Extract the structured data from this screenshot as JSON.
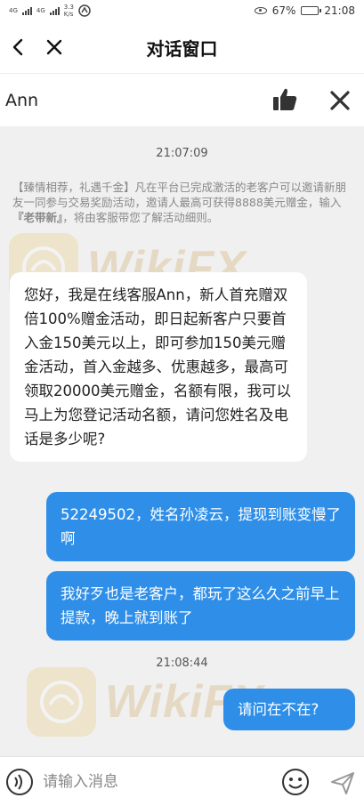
{
  "status_bar": {
    "net_label_1": "4G",
    "net_label_2": "4G",
    "speed_value": "3.3",
    "speed_unit": "K/s",
    "battery_percent": "67%",
    "battery_level": 0.67,
    "time": "21:08"
  },
  "titlebar": {
    "title": "对话窗口",
    "back_icon": "chevron-left-icon",
    "close_icon": "close-icon"
  },
  "agentbar": {
    "name": "Ann",
    "like_icon": "thumbs-up-icon",
    "close_icon": "close-icon"
  },
  "chat": {
    "timestamp_1": "21:07:09",
    "notice": {
      "part1": "【臻情相荐，礼遇千金】凡在平台已完成激活的老客户可以邀请新朋友一同参与交易奖励活动，邀请人最高可获得8888美元赠金，输入",
      "highlight": "『老带新』",
      "part2": "，将由客服带您了解活动细则。"
    },
    "agent_message": "您好，我是在线客服Ann，新人首充赠双倍100%赠金活动，即日起新客户只要首入金150美元以上，即可参加150美元赠金活动，首入金越多、优惠越多，最高可领取20000美元赠金，名额有限，我可以马上为您登记活动名额，请问您姓名及电话是多少呢?",
    "user_message_1": "52249502，姓名孙凌云，提现到账变慢了啊",
    "user_message_2": "我好歹也是老客户，都玩了这么久之前早上提款，晚上就到账了",
    "timestamp_2": "21:08:44",
    "user_message_3": "请问在不在?",
    "watermark_text": "WikiFX"
  },
  "inputbar": {
    "placeholder": "请输入消息",
    "voice_icon": "voice-icon",
    "emoji_icon": "emoji-icon",
    "send_icon": "send-icon"
  },
  "colors": {
    "outgoing_bubble": "#2f8fe8",
    "incoming_bubble": "#ffffff",
    "chat_background": "#f0f0f0",
    "watermark": "#c08a2a"
  }
}
